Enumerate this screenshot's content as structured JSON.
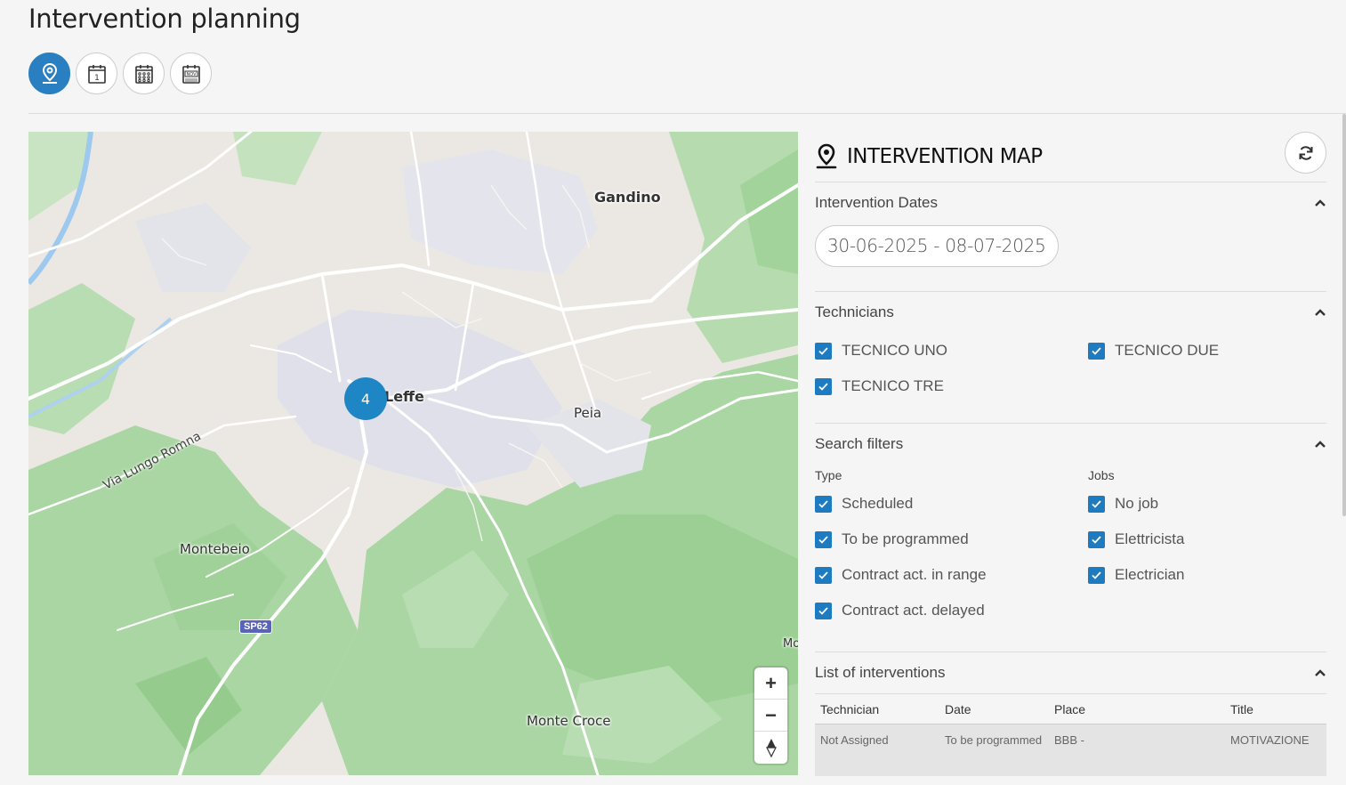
{
  "page": {
    "title": "Intervention planning"
  },
  "view_buttons": [
    {
      "icon": "map-pin-icon",
      "active": true
    },
    {
      "icon": "calendar-day-icon",
      "active": false,
      "text": "1"
    },
    {
      "icon": "calendar-month-icon",
      "active": false
    },
    {
      "icon": "calendar-year-icon",
      "active": false,
      "text": "NOV"
    }
  ],
  "map": {
    "labels": {
      "gandino": "Gandino",
      "leffe": "Leffe",
      "peia": "Peia",
      "montebeio": "Montebeio",
      "monte_croce": "Monte Croce",
      "mo": "Mo",
      "road": "Via Lungo Romna",
      "sp62": "SP62"
    },
    "cluster_count": "4",
    "zoom_in": "+",
    "zoom_out": "−",
    "reset": "⇕"
  },
  "panel": {
    "title": "INTERVENTION MAP",
    "dates": {
      "title": "Intervention Dates",
      "value": "30-06-2025 - 08-07-2025"
    },
    "technicians": {
      "title": "Technicians",
      "items": [
        "TECNICO UNO",
        "TECNICO DUE",
        "TECNICO TRE"
      ]
    },
    "filters": {
      "title": "Search filters",
      "type_label": "Type",
      "jobs_label": "Jobs",
      "type_items": [
        "Scheduled",
        "To be programmed",
        "Contract act. in range",
        "Contract act. delayed"
      ],
      "job_items": [
        "No job",
        "Elettricista",
        "Electrician"
      ]
    },
    "list": {
      "title": "List of interventions",
      "columns": [
        "Technician",
        "Date",
        "Place",
        "Title"
      ],
      "rows": [
        {
          "technician": "Not Assigned",
          "date": "To be programmed",
          "place": "BBB -",
          "title": "MOTIVAZIONE"
        }
      ]
    }
  },
  "colors": {
    "accent": "#1f7bbf",
    "cluster": "#1f86c6",
    "map_green": "#a9d8a4"
  }
}
